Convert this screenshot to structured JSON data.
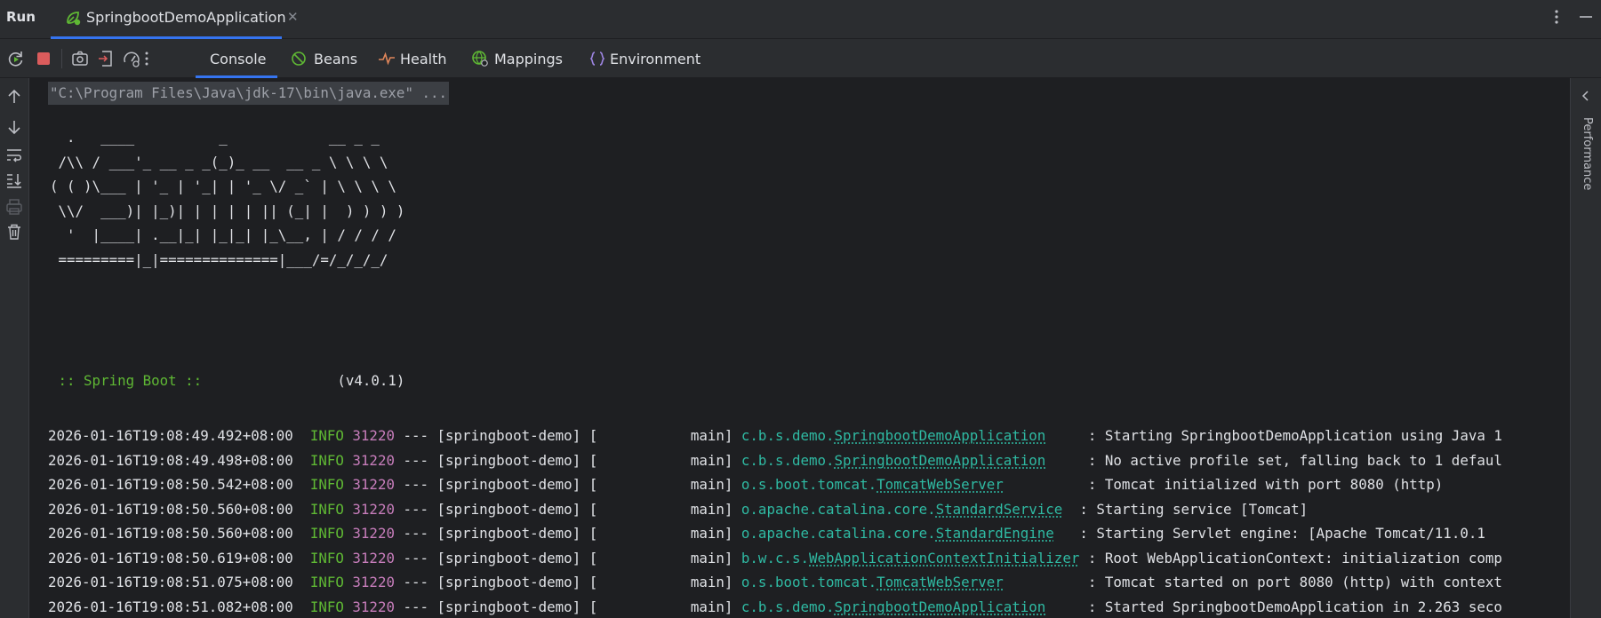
{
  "window": {
    "run_label": "Run",
    "tab_title": "SpringbootDemoApplication"
  },
  "toolbar": {
    "subtabs": [
      {
        "label": "Console",
        "icon": "console",
        "active": true
      },
      {
        "label": "Beans",
        "icon": "beans-icon"
      },
      {
        "label": "Health",
        "icon": "health-icon"
      },
      {
        "label": "Mappings",
        "icon": "mappings-icon"
      },
      {
        "label": "Environment",
        "icon": "environment-icon"
      }
    ]
  },
  "right_rail": {
    "label": "Performance"
  },
  "console": {
    "command_line": "\"C:\\Program Files\\Java\\jdk-17\\bin\\java.exe\" ...",
    "banner": "  .   ____          _            __ _ _\n /\\\\ / ___'_ __ _ _(_)_ __  __ _ \\ \\ \\ \\\n( ( )\\___ | '_ | '_| | '_ \\/ _` | \\ \\ \\ \\\n \\\\/  ___)| |_)| | | | | || (_| |  ) ) ) )\n  '  |____| .__|_| |_|_| |_\\__, | / / / /\n =========|_|==============|___/=/_/_/_/",
    "boot_label": " :: Spring Boot :: ",
    "boot_version": "               (v4.0.1)",
    "log_rows": [
      {
        "ts": "2026-01-16T19:08:49.492+08:00",
        "level": "INFO",
        "pid": "31220",
        "mid": " --- [springboot-demo] [           main] ",
        "pkg": "c.b.s.demo.",
        "cls": "SpringbootDemoApplication",
        "pad": "     ",
        "msg": ": Starting SpringbootDemoApplication using Java 1"
      },
      {
        "ts": "2026-01-16T19:08:49.498+08:00",
        "level": "INFO",
        "pid": "31220",
        "mid": " --- [springboot-demo] [           main] ",
        "pkg": "c.b.s.demo.",
        "cls": "SpringbootDemoApplication",
        "pad": "     ",
        "msg": ": No active profile set, falling back to 1 defaul"
      },
      {
        "ts": "2026-01-16T19:08:50.542+08:00",
        "level": "INFO",
        "pid": "31220",
        "mid": " --- [springboot-demo] [           main] ",
        "pkg": "o.s.boot.tomcat.",
        "cls": "TomcatWebServer",
        "pad": "          ",
        "msg": ": Tomcat initialized with port 8080 (http)"
      },
      {
        "ts": "2026-01-16T19:08:50.560+08:00",
        "level": "INFO",
        "pid": "31220",
        "mid": " --- [springboot-demo] [           main] ",
        "pkg": "o.apache.catalina.core.",
        "cls": "StandardService",
        "pad": "  ",
        "msg": ": Starting service [Tomcat]"
      },
      {
        "ts": "2026-01-16T19:08:50.560+08:00",
        "level": "INFO",
        "pid": "31220",
        "mid": " --- [springboot-demo] [           main] ",
        "pkg": "o.apache.catalina.core.",
        "cls": "StandardEngine",
        "pad": "   ",
        "msg": ": Starting Servlet engine: [Apache Tomcat/11.0.1"
      },
      {
        "ts": "2026-01-16T19:08:50.619+08:00",
        "level": "INFO",
        "pid": "31220",
        "mid": " --- [springboot-demo] [           main] ",
        "pkg": "b.w.c.s.",
        "cls": "WebApplicationContextInitializer",
        "pad": " ",
        "msg": ": Root WebApplicationContext: initialization comp"
      },
      {
        "ts": "2026-01-16T19:08:51.075+08:00",
        "level": "INFO",
        "pid": "31220",
        "mid": " --- [springboot-demo] [           main] ",
        "pkg": "o.s.boot.tomcat.",
        "cls": "TomcatWebServer",
        "pad": "          ",
        "msg": ": Tomcat started on port 8080 (http) with context"
      },
      {
        "ts": "2026-01-16T19:08:51.082+08:00",
        "level": "INFO",
        "pid": "31220",
        "mid": " --- [springboot-demo] [           main] ",
        "pkg": "c.b.s.demo.",
        "cls": "SpringbootDemoApplication",
        "pad": "     ",
        "msg": ": Started SpringbootDemoApplication in 2.263 seco"
      }
    ]
  },
  "colors": {
    "background": "#1e1f22",
    "panel": "#2b2d30",
    "accent": "#3574f0",
    "info": "#5fb834",
    "pid": "#c77dbb",
    "logger": "#2fbaa3",
    "stop": "#db5c5c"
  }
}
